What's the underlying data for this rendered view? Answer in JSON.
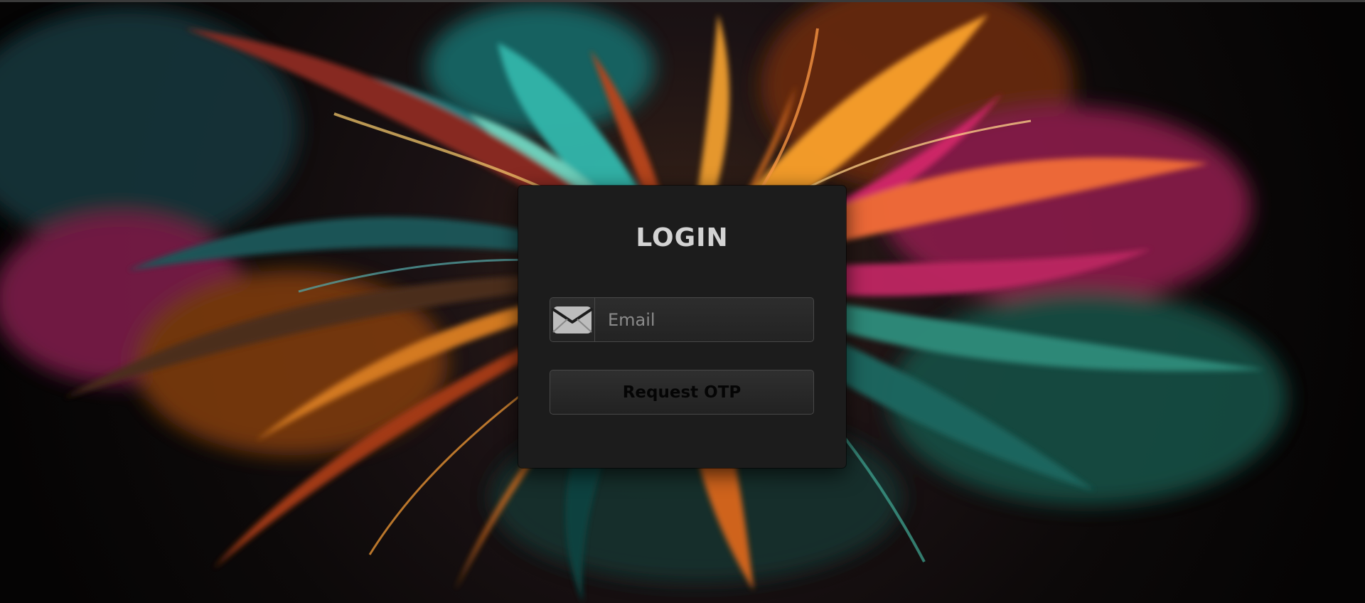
{
  "login": {
    "title": "LOGIN",
    "email_placeholder": "Email",
    "email_value": "",
    "email_icon": "envelope-icon",
    "request_button_label": "Request OTP"
  },
  "colors": {
    "card_background": "#1c1c1c",
    "title_text": "#d3d3d3",
    "input_border": "#474747",
    "button_text": "#050505"
  }
}
